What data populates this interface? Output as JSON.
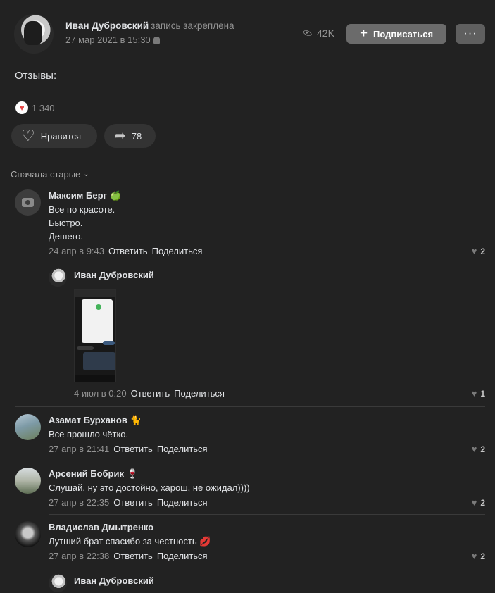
{
  "post": {
    "author": "Иван Дубровский",
    "pinned": "запись закреплена",
    "date": "27 мар 2021 в 15:30",
    "views": "42K",
    "subscribe_label": "Подписаться",
    "more_label": "···",
    "text": "Отзывы:",
    "reactions_count": "1 340",
    "like_label": "Нравится",
    "share_count": "78"
  },
  "comments_sort": "Сначала старые",
  "comments": [
    {
      "name": "Максим Берг",
      "emoji": "🍏",
      "lines": [
        "Все по красоте.",
        "Быстро.",
        "Дешего."
      ],
      "date": "24 апр в 9:43",
      "reply": "Ответить",
      "share": "Поделиться",
      "likes": "2"
    },
    {
      "name": "Иван Дубровский",
      "date": "4 июл в 0:20",
      "reply": "Ответить",
      "share": "Поделиться",
      "likes": "1"
    },
    {
      "name": "Азамат Бурханов",
      "emoji": "🐈",
      "text": "Все прошло чётко.",
      "date": "27 апр в 21:41",
      "reply": "Ответить",
      "share": "Поделиться",
      "likes": "2"
    },
    {
      "name": "Арсений Бобрик",
      "emoji": "🍷",
      "text": "Слушай, ну это достойно, харош, не ожидал))))",
      "date": "27 апр в 22:35",
      "reply": "Ответить",
      "share": "Поделиться",
      "likes": "2"
    },
    {
      "name": "Владислав Дмытренко",
      "text": "Лутший брат спасибо за честность",
      "text_emoji": "💋",
      "date": "27 апр в 22:38",
      "reply": "Ответить",
      "share": "Поделиться",
      "likes": "2"
    },
    {
      "name": "Иван Дубровский"
    }
  ],
  "icons": {
    "reaction": "heart-icon",
    "like": "heart-outline-icon",
    "share": "share-arrow-icon",
    "views": "eye-icon",
    "avatar_placeholder": "camera-icon"
  },
  "colors": {
    "background": "#222222",
    "button_bg": "#333333",
    "subscribe_bg": "#6b6b6b",
    "reaction_heart": "#e64646",
    "muted_text": "#939393"
  }
}
